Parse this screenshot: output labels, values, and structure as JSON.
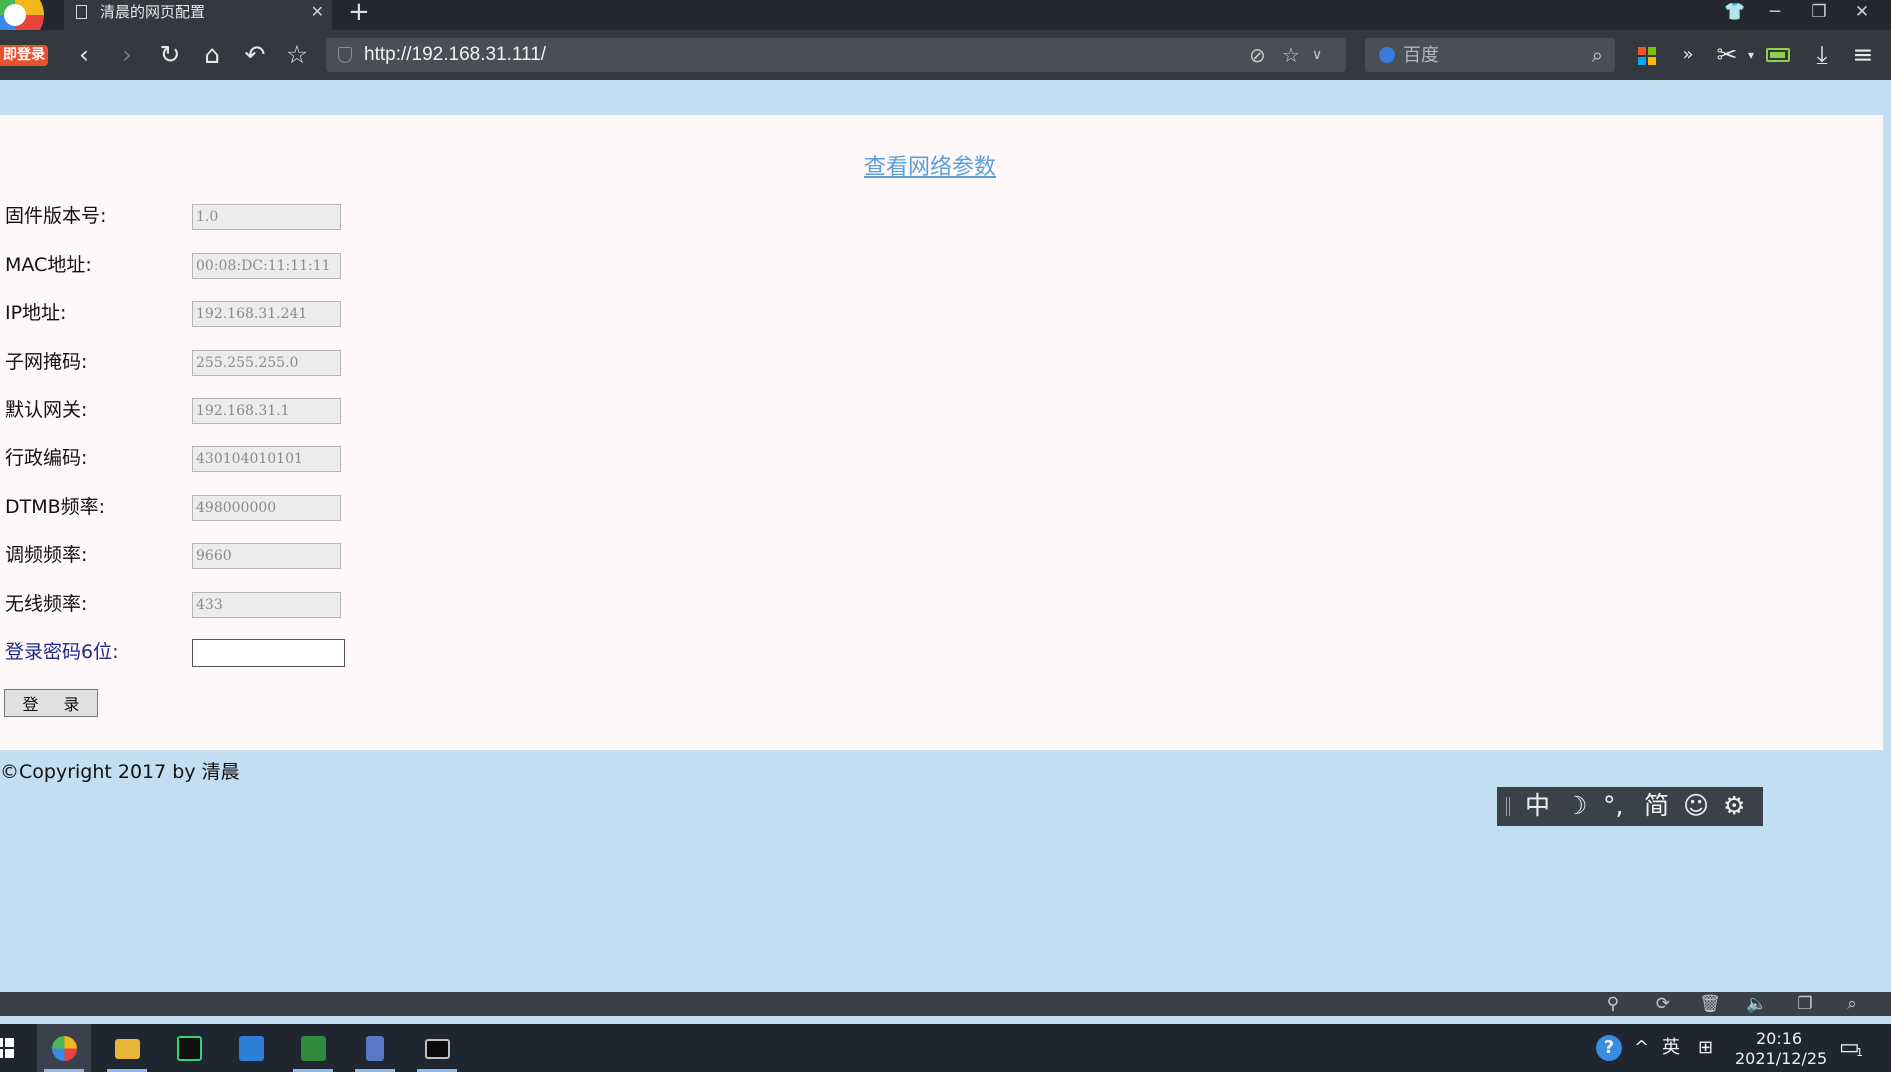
{
  "browser": {
    "tab_title": "清晨的网页配置",
    "tab_close": "✕",
    "new_tab": "+",
    "login_badge": "即登录",
    "url": "http://192.168.31.111/",
    "search_placeholder": "百度",
    "window_buttons": {
      "skin": "👕",
      "minimize": "─",
      "restore": "❐",
      "close": "✕"
    }
  },
  "page": {
    "heading": "查看网络参数",
    "fields": [
      {
        "label": "固件版本号:",
        "value": "1.0"
      },
      {
        "label": "MAC地址:",
        "value": "00:08:DC:11:11:11"
      },
      {
        "label": "IP地址:",
        "value": "192.168.31.241"
      },
      {
        "label": "子网掩码:",
        "value": "255.255.255.0"
      },
      {
        "label": "默认网关:",
        "value": "192.168.31.1"
      },
      {
        "label": "行政编码:",
        "value": "430104010101"
      },
      {
        "label": "DTMB频率:",
        "value": "498000000"
      },
      {
        "label": "调频频率:",
        "value": "9660"
      },
      {
        "label": "无线频率:",
        "value": "433"
      }
    ],
    "password_label": "登录密码6位:",
    "password_value": "",
    "login_button": "登 录",
    "copyright": "©Copyright 2017 by 清晨"
  },
  "ime": {
    "lang": "中",
    "moon": "☽",
    "punct": "°,",
    "simplified": "简",
    "emoji": "☺",
    "settings": "⚙"
  },
  "taskbar": {
    "tray": {
      "help": "?",
      "chevron": "^",
      "lang": "英",
      "keyboard": "⊞"
    },
    "time": "20:16",
    "date": "2021/12/25",
    "notification_count": "1"
  }
}
